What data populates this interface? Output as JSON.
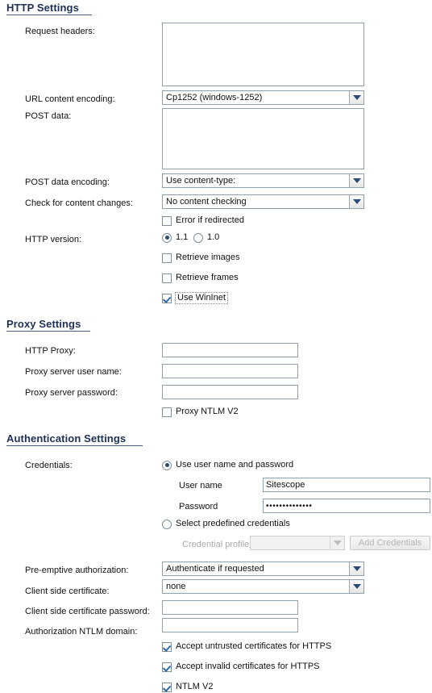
{
  "sections": {
    "http": {
      "title": "HTTP Settings",
      "labels": {
        "request_headers": "Request headers:",
        "url_content_encoding": "URL content encoding:",
        "post_data": "POST data:",
        "post_data_encoding": "POST data encoding:",
        "check_content_changes": "Check for content changes:",
        "http_version": "HTTP version:"
      },
      "values": {
        "request_headers": "",
        "url_content_encoding": "Cp1252 (windows-1252)",
        "post_data": "",
        "post_data_encoding": "Use content-type:",
        "check_content_changes": "No content checking"
      },
      "checks": {
        "error_if_redirected": {
          "label": "Error if redirected",
          "checked": false
        },
        "retrieve_images": {
          "label": "Retrieve images",
          "checked": false
        },
        "retrieve_frames": {
          "label": "Retrieve frames",
          "checked": false
        },
        "use_wininet": {
          "label": "Use WinInet",
          "checked": true,
          "focused": true
        }
      },
      "version_radios": [
        {
          "label": "1.1",
          "selected": true
        },
        {
          "label": "1.0",
          "selected": false
        }
      ]
    },
    "proxy": {
      "title": "Proxy Settings",
      "labels": {
        "http_proxy": "HTTP Proxy:",
        "proxy_user": "Proxy server user name:",
        "proxy_password": "Proxy server password:"
      },
      "values": {
        "http_proxy": "",
        "proxy_user": "",
        "proxy_password": ""
      },
      "checks": {
        "proxy_ntlm_v2": {
          "label": "Proxy NTLM V2",
          "checked": false
        }
      }
    },
    "auth": {
      "title": "Authentication Settings",
      "labels": {
        "credentials": "Credentials:",
        "user_name": "User name",
        "password": "Password",
        "credential_profile": "Credential profile",
        "preemptive_auth": "Pre-emptive authorization:",
        "client_cert": "Client side certificate:",
        "client_cert_password": "Client side certificate password:",
        "auth_ntlm_domain": "Authorization NTLM domain:"
      },
      "radios": {
        "use_username_password": {
          "label": "Use user name and password",
          "selected": true
        },
        "select_predefined": {
          "label": "Select predefined credentials",
          "selected": false
        }
      },
      "values": {
        "user_name": "Sitescope",
        "password": "••••••••••••••",
        "credential_profile": "",
        "preemptive_auth": "Authenticate if requested",
        "client_cert": "none",
        "client_cert_password": "",
        "auth_ntlm_domain": ""
      },
      "buttons": {
        "add_credentials": "Add Credentials"
      },
      "checks": {
        "accept_untrusted": {
          "label": "Accept untrusted certificates for HTTPS",
          "checked": true
        },
        "accept_invalid": {
          "label": "Accept invalid certificates for HTTPS",
          "checked": true
        },
        "ntlm_v2": {
          "label": "NTLM V2",
          "checked": true
        }
      }
    }
  },
  "colors": {
    "heading": "#1d3055",
    "border": "#8fa0b0",
    "accent": "#2b4a74",
    "disabled_text": "#b6b6b6"
  }
}
